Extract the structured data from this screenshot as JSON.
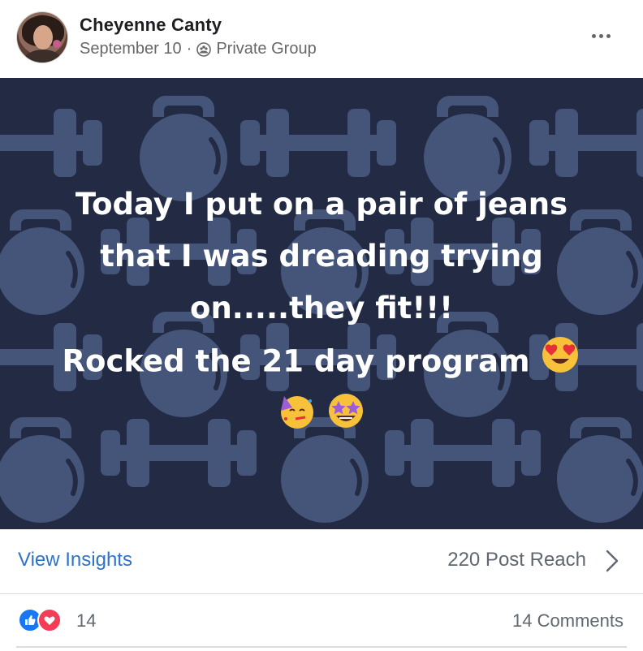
{
  "post": {
    "author": "Cheyenne Canty",
    "date": "September 10",
    "separator": "·",
    "audience": "Private Group",
    "icons": {
      "avatar": "profile-photo",
      "audience": "group-icon",
      "more": "more-options-icon"
    }
  },
  "banner": {
    "background_color": "#222b43",
    "pattern_color": "#45557a",
    "text_lines": [
      "Today I put on a pair of jeans",
      "that I was dreading trying",
      "on.....they fit!!!",
      "Rocked the 21 day program"
    ],
    "emoji": [
      "heart-eyes-emoji",
      "partying-face-emoji",
      "star-struck-emoji"
    ]
  },
  "insights": {
    "link_label": "View Insights",
    "reach_label": "220 Post Reach",
    "link_color": "#2d73c8"
  },
  "engagement": {
    "reaction_count": "14",
    "comments_label": "14 Comments",
    "reaction_types": [
      "like",
      "love"
    ]
  }
}
